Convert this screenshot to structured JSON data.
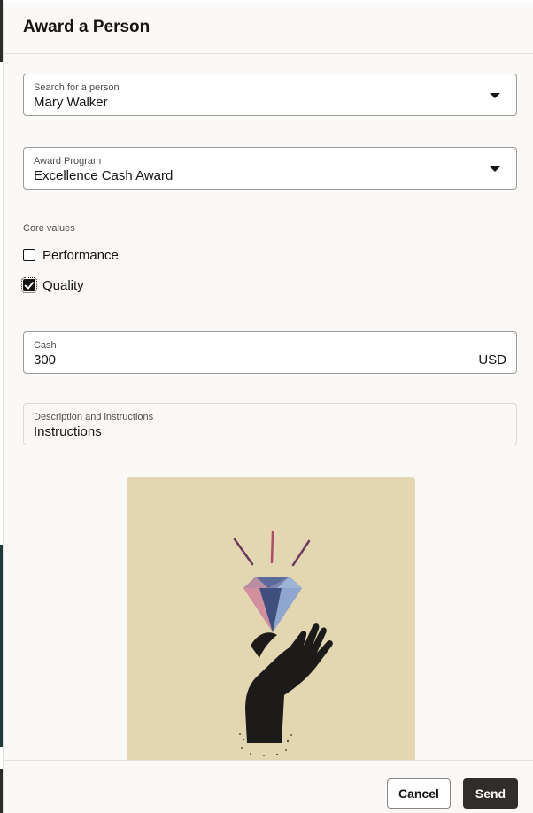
{
  "dialog": {
    "title": "Award a Person"
  },
  "person_field": {
    "label": "Search for a person",
    "value": "Mary Walker"
  },
  "program_field": {
    "label": "Award Program",
    "value": "Excellence Cash Award"
  },
  "core_values": {
    "label": "Core values",
    "options": [
      {
        "label": "Performance",
        "checked": false
      },
      {
        "label": "Quality",
        "checked": true
      }
    ]
  },
  "cash_field": {
    "label": "Cash",
    "value": "300",
    "currency": "USD"
  },
  "description_field": {
    "label": "Description and instructions",
    "value": "Instructions"
  },
  "illustration": {
    "icon": "diamond-in-hand-illustration",
    "background": "#e6dab6"
  },
  "footer": {
    "cancel_label": "Cancel",
    "send_label": "Send"
  },
  "colors": {
    "primary_button": "#312d2a",
    "text": "#161513",
    "panel_background": "#fbf9f8"
  }
}
